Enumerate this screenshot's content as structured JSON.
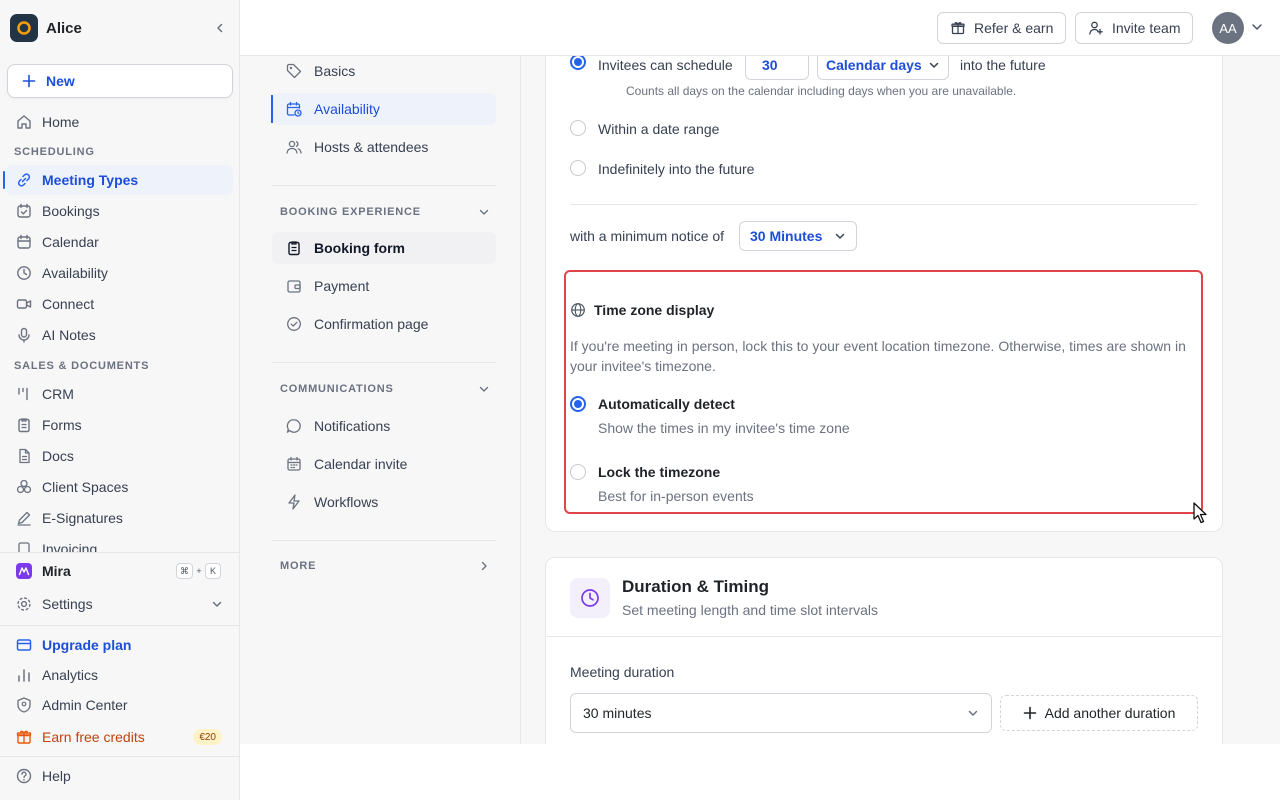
{
  "workspace": {
    "name": "Alice"
  },
  "sidebar": {
    "new_label": "New",
    "home": "Home",
    "section_scheduling": "SCHEDULING",
    "scheduling_items": [
      "Meeting Types",
      "Bookings",
      "Calendar",
      "Availability",
      "Connect",
      "AI Notes"
    ],
    "section_sales": "SALES & DOCUMENTS",
    "sales_items": [
      "CRM",
      "Forms",
      "Docs",
      "Client Spaces",
      "E-Signatures",
      "Invoicing"
    ],
    "mira": "Mira",
    "shortcut": {
      "mod": "⌘",
      "plus": "+",
      "key": "K"
    },
    "settings": "Settings",
    "upgrade": "Upgrade plan",
    "analytics": "Analytics",
    "admin": "Admin Center",
    "earn": "Earn free credits",
    "earn_badge": "€20",
    "help": "Help"
  },
  "header": {
    "refer": "Refer & earn",
    "invite": "Invite team",
    "avatar_initials": "AA"
  },
  "subnav": {
    "items_top": [
      "Basics",
      "Availability",
      "Hosts & attendees"
    ],
    "section_booking": "BOOKING EXPERIENCE",
    "booking_items": [
      "Booking form",
      "Payment",
      "Confirmation page"
    ],
    "section_comms": "COMMUNICATIONS",
    "comms_items": [
      "Notifications",
      "Calendar invite",
      "Workflows"
    ],
    "section_more": "MORE"
  },
  "availability": {
    "schedule_prefix": "Invitees can schedule",
    "schedule_value": "30",
    "schedule_unit": "Calendar days",
    "schedule_suffix": "into the future",
    "schedule_hint": "Counts all days on the calendar including days when you are unavailable.",
    "option_range": "Within a date range",
    "option_indefinite": "Indefinitely into the future",
    "notice_prefix": "with a minimum notice of",
    "notice_value": "30 Minutes"
  },
  "timezone": {
    "title": "Time zone display",
    "description": "If you're meeting in person, lock this to your event location timezone. Otherwise, times are shown in your invitee's timezone.",
    "auto_title": "Automatically detect",
    "auto_desc": "Show the times in my invitee's time zone",
    "lock_title": "Lock the timezone",
    "lock_desc": "Best for in-person events"
  },
  "duration": {
    "title": "Duration & Timing",
    "subtitle": "Set meeting length and time slot intervals",
    "label": "Meeting duration",
    "value": "30 minutes",
    "add_label": "Add another duration"
  },
  "colors": {
    "accent": "#2563eb",
    "highlight": "#e0434b",
    "purple": "#7c3aed"
  }
}
